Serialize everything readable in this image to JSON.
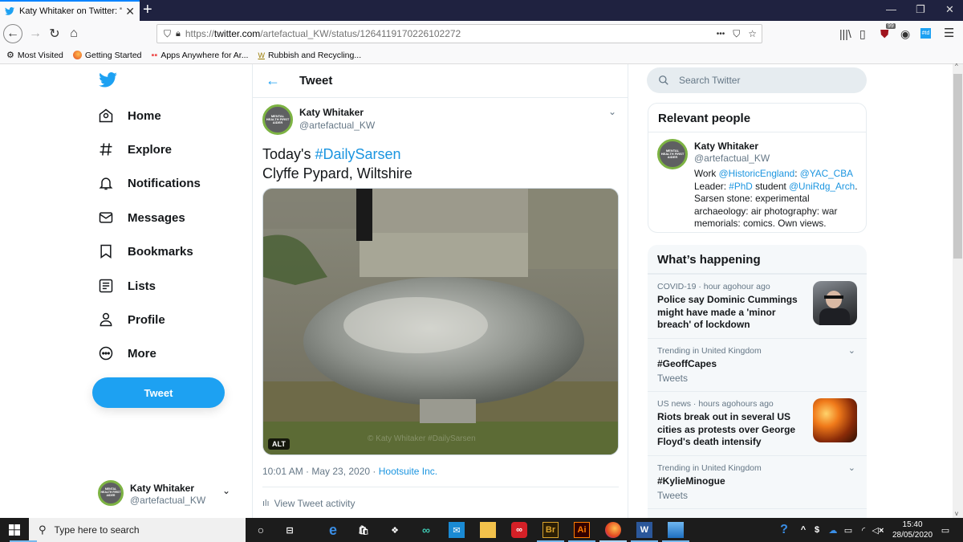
{
  "browser": {
    "tab_title": "Katy Whitaker on Twitter: \"Toda",
    "new_tab": "+",
    "url_prefix": "https://",
    "url_host": "twitter.com",
    "url_path": "/artefactual_KW/status/1264119170226102272",
    "url_more": "•••",
    "ublock_count": "99",
    "ext_label": "#td",
    "bookmarks": [
      {
        "label": "Most Visited",
        "icon": "gear-icon"
      },
      {
        "label": "Getting Started",
        "icon": "firefox-icon"
      },
      {
        "label": "Apps Anywhere for Ar...",
        "icon": "apps-icon"
      },
      {
        "label": "Rubbish and Recycling...",
        "icon": "w-icon"
      }
    ]
  },
  "nav": {
    "items": [
      {
        "label": "Home",
        "icon": "home-icon"
      },
      {
        "label": "Explore",
        "icon": "hashtag-icon"
      },
      {
        "label": "Notifications",
        "icon": "bell-icon"
      },
      {
        "label": "Messages",
        "icon": "envelope-icon"
      },
      {
        "label": "Bookmarks",
        "icon": "bookmark-icon"
      },
      {
        "label": "Lists",
        "icon": "list-icon"
      },
      {
        "label": "Profile",
        "icon": "person-icon"
      },
      {
        "label": "More",
        "icon": "more-icon"
      }
    ],
    "tweet_button": "Tweet",
    "account_name": "Katy Whitaker",
    "account_handle": "@artefactual_KW"
  },
  "avatar_text": "MENTAL HEALTH FIRST AIDER",
  "tweet": {
    "header": "Tweet",
    "author_name": "Katy Whitaker",
    "author_handle": "@artefactual_KW",
    "text_prefix": "Today's ",
    "hashtag": "#DailySarsen",
    "text_line2": "Clyffe Pypard, Wiltshire",
    "alt_badge": "ALT",
    "watermark": "© Katy Whitaker #DailySarsen",
    "time": "10:01 AM · May 23, 2020 · ",
    "source": "Hootsuite Inc.",
    "activity": "View Tweet activity"
  },
  "sidebar": {
    "search_placeholder": "Search Twitter",
    "relevant": {
      "title": "Relevant people",
      "name": "Katy Whitaker",
      "handle": "@artefactual_KW",
      "bio": [
        {
          "t": "Work ",
          "link": false
        },
        {
          "t": "@HistoricEngland",
          "link": true
        },
        {
          "t": ": ",
          "link": false
        },
        {
          "t": "@YAC_CBA",
          "link": true
        },
        {
          "t": " Leader: ",
          "link": false
        },
        {
          "t": "#PhD",
          "link": true
        },
        {
          "t": " student ",
          "link": false
        },
        {
          "t": "@UniRdg_Arch",
          "link": true
        },
        {
          "t": ". Sarsen stone: experimental archaeology: air photography: war memorials: comics. Own views.",
          "link": false
        }
      ]
    },
    "happening": {
      "title": "What’s happening",
      "trends": [
        {
          "meta": "COVID-19 · hour agohour ago",
          "title": "Police say Dominic Cummings might have made a 'minor breach' of lockdown",
          "sub": "",
          "thumb": "photo"
        },
        {
          "meta": "Trending in United Kingdom",
          "title": "#GeoffCapes",
          "sub": "Tweets",
          "thumb": "caret"
        },
        {
          "meta": "US news · hours agohours ago",
          "title": "Riots break out in several US cities as protests over George Floyd's death intensify",
          "sub": "",
          "thumb": "fire"
        },
        {
          "meta": "Trending in United Kingdom",
          "title": "#KylieMinogue",
          "sub": "Tweets",
          "thumb": "caret"
        }
      ]
    }
  },
  "taskbar": {
    "search_placeholder": "Type here to search",
    "time": "15:40",
    "date": "28/05/2020",
    "apps": [
      "Br",
      "Ai",
      "W"
    ]
  },
  "colors": {
    "twitter_blue": "#1da1f2",
    "link_blue": "#1b95e0",
    "avatar_ring": "#7db343"
  }
}
